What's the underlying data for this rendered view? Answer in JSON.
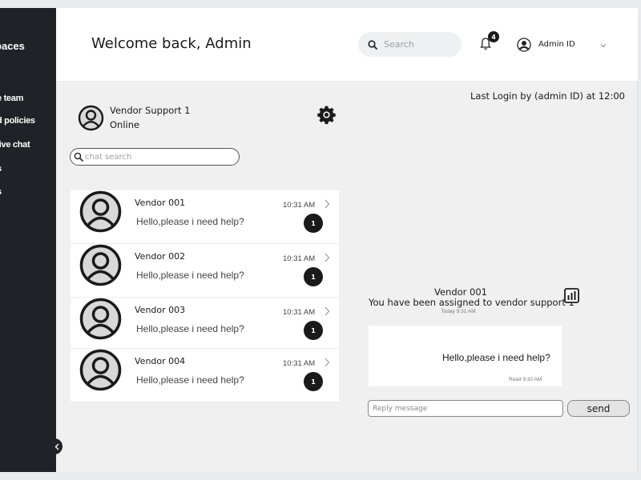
{
  "sidebar": {
    "brand": "paces",
    "items": [
      {
        "label": "e team"
      },
      {
        "label": "d policies"
      },
      {
        "label": " live chat"
      },
      {
        "label": "s"
      },
      {
        "label": "s"
      }
    ]
  },
  "header": {
    "welcome": "Welcome back, Admin",
    "search_placeholder": "Search",
    "notification_count": "4",
    "admin_label": "Admin ID"
  },
  "info": {
    "last_login": "Last Login by (admin ID) at 12:00"
  },
  "agent": {
    "name": "Vendor Support 1",
    "status": "Online"
  },
  "chat_search": {
    "placeholder": "chat search"
  },
  "conversations": [
    {
      "name": "Vendor 001",
      "message": "Hello,please i need help?",
      "time": "10:31 AM",
      "unread": "1"
    },
    {
      "name": "Vendor 002",
      "message": "Hello,please i need help?",
      "time": "10:31 AM",
      "unread": "1"
    },
    {
      "name": "Vendor 003",
      "message": "Hello,please i need help?",
      "time": "10:31 AM",
      "unread": "1"
    },
    {
      "name": "Vendor 004",
      "message": "Hello,please i need help?",
      "time": "10:31 AM",
      "unread": "1"
    }
  ],
  "chat": {
    "vendor": "Vendor 001",
    "assigned": "You have been assigned to vendor support 1",
    "date": "Today 9:31 AM",
    "message": "Hello,please i need help?",
    "read": "Read 9:30 AM",
    "reply_placeholder": "Reply message",
    "send_label": "send"
  },
  "icons": {
    "search": "search-icon",
    "bell": "bell-icon",
    "user": "user-icon",
    "chevron_down": "chevron-down-icon",
    "chevron_right": "chevron-right-icon",
    "chevron_left": "chevron-left-icon",
    "gear": "gear-icon",
    "stats": "bar-chart-icon"
  },
  "colors": {
    "sidebar": "#1f2226",
    "background": "#f0f0f0",
    "badge": "#1a1a1a"
  }
}
